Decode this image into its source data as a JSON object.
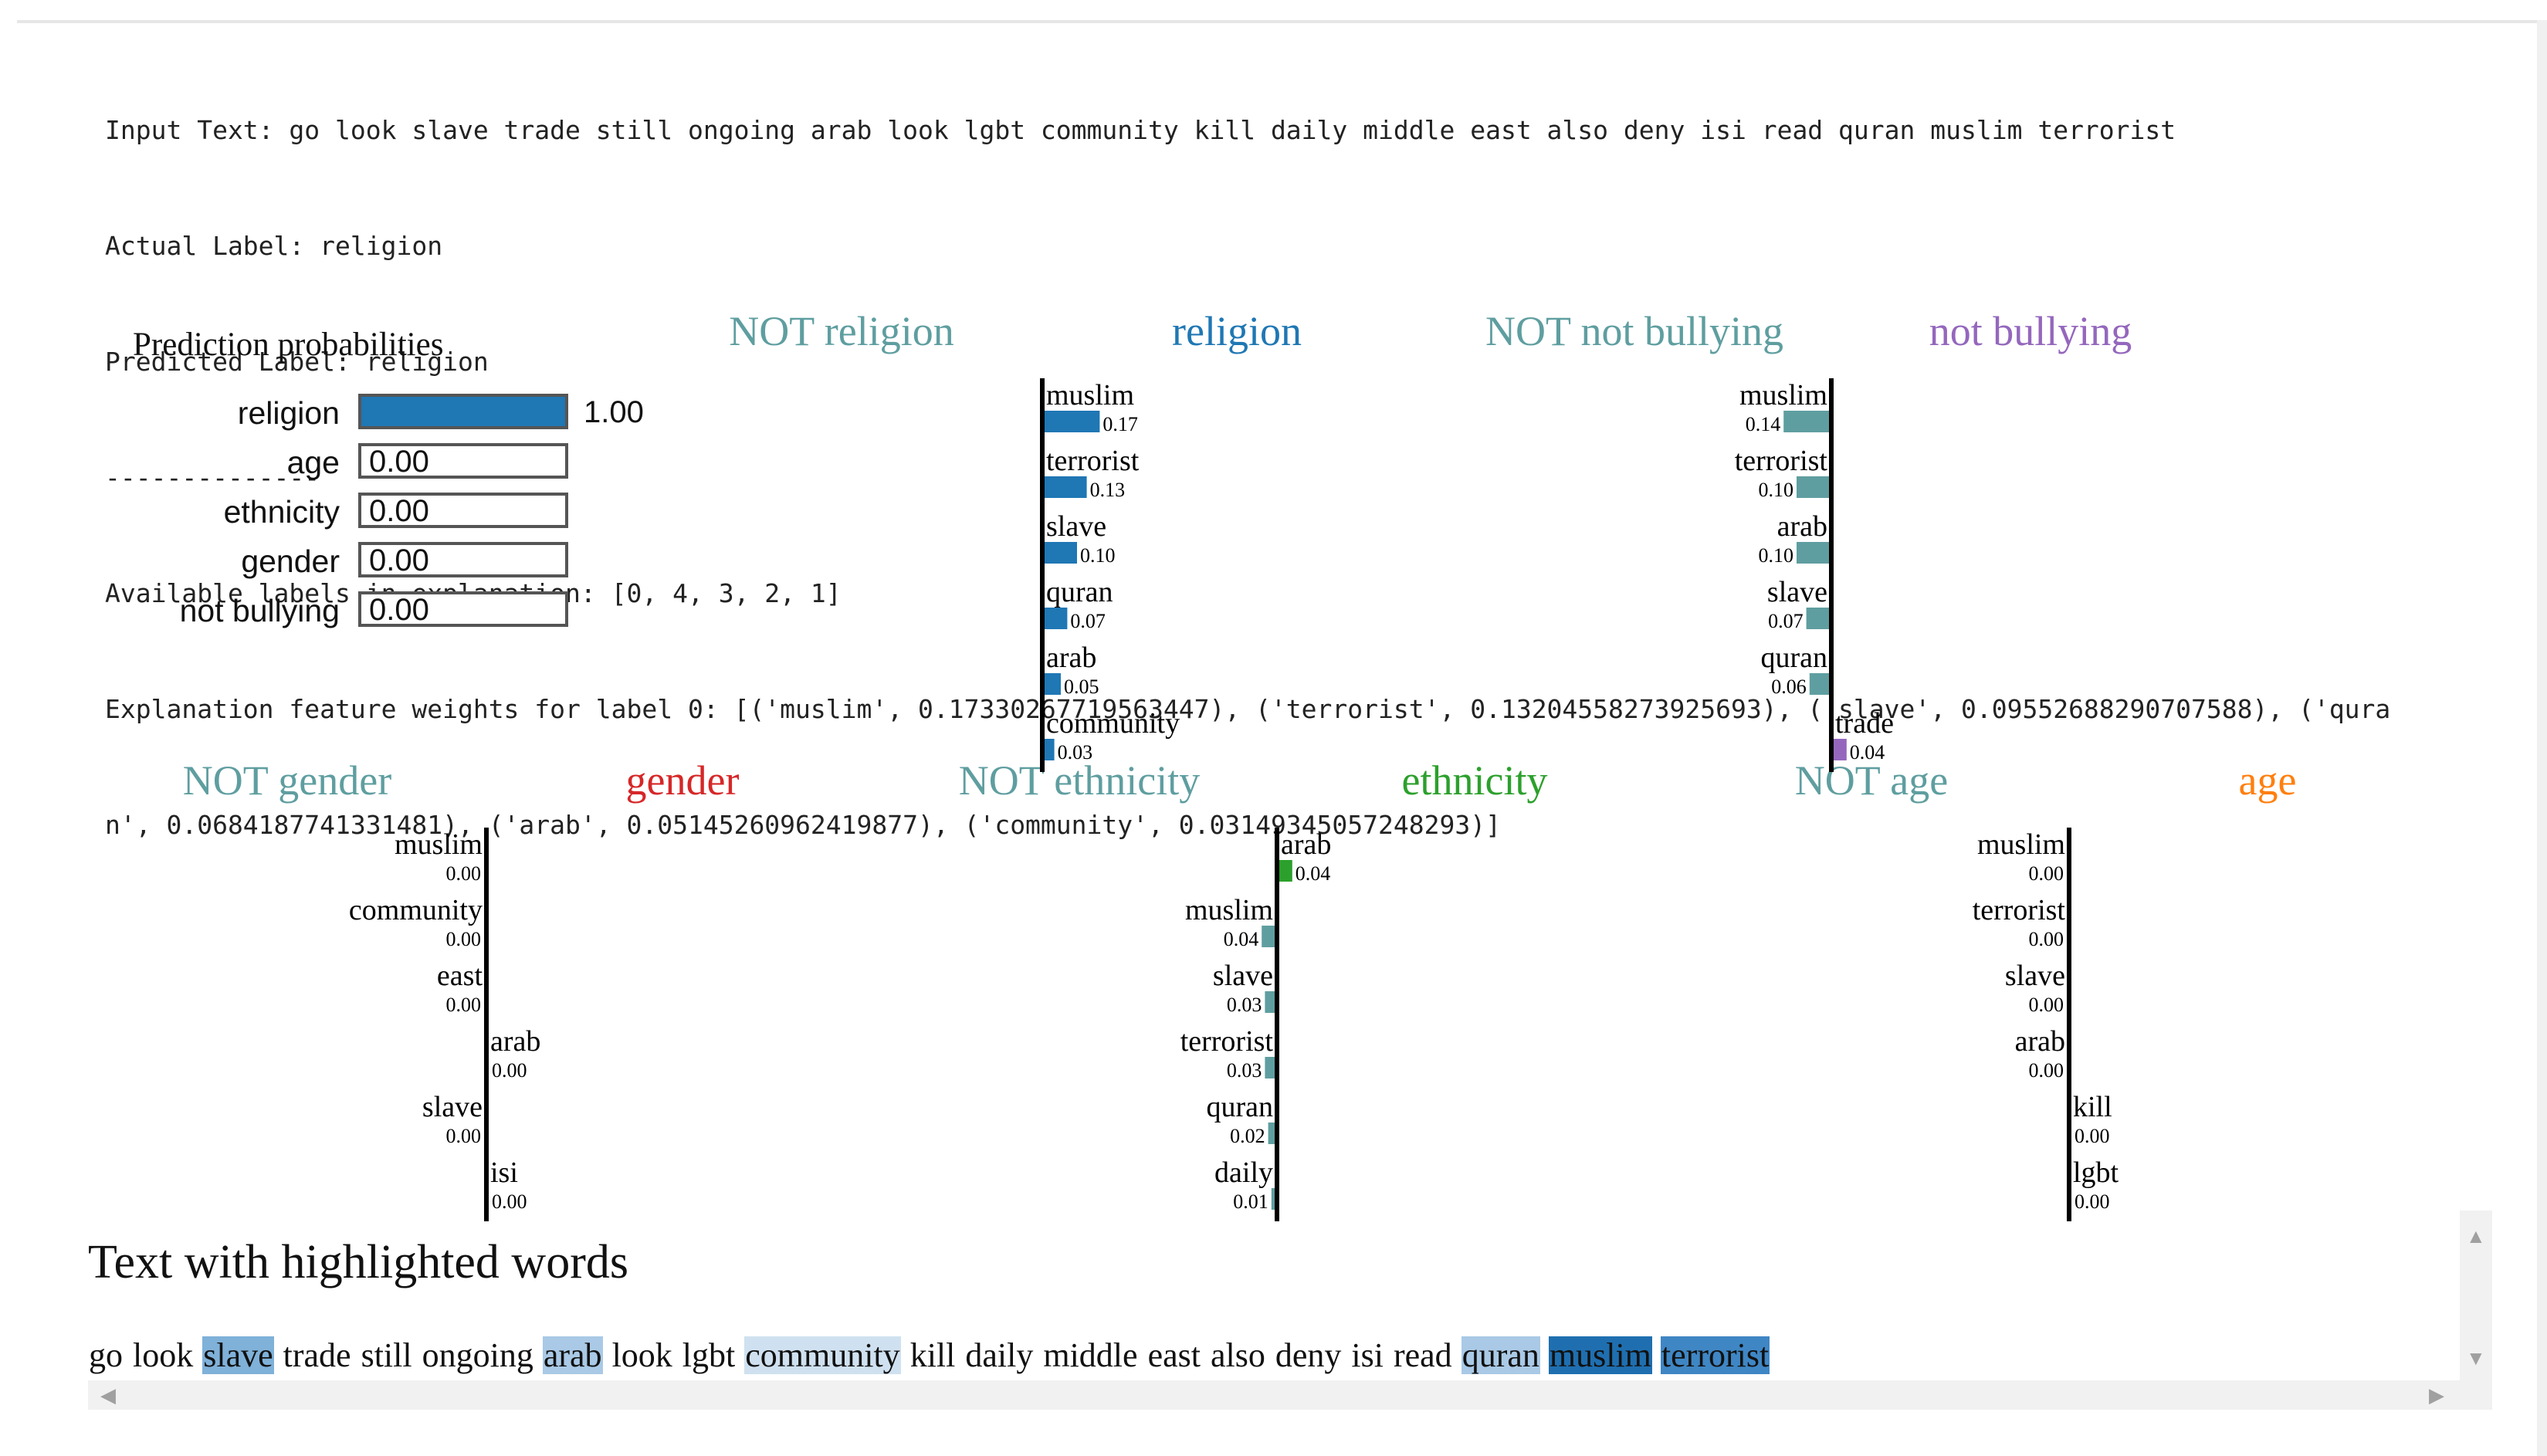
{
  "console": {
    "lines": [
      "Input Text: go look slave trade still ongoing arab look lgbt community kill daily middle east also deny isi read quran muslim terrorist",
      "Actual Label: religion",
      "Predicted Label: religion",
      "--------------",
      "Available labels in explanation: [0, 4, 3, 2, 1]",
      "Explanation feature weights for label 0: [('muslim', 0.17330267719563447), ('terrorist', 0.13204558273925693), ('slave', 0.09552688290707588), ('qura",
      "n', 0.0684187741331481), ('arab', 0.05145260962419877), ('community', 0.03149345057248293)]"
    ]
  },
  "prediction": {
    "title": "Prediction probabilities",
    "rows": [
      {
        "label": "religion",
        "value": 1.0,
        "value_text": "1.00",
        "color": "#1f77b4"
      },
      {
        "label": "age",
        "value": 0.0,
        "value_text": "0.00",
        "color": "#ff7f0e"
      },
      {
        "label": "ethnicity",
        "value": 0.0,
        "value_text": "0.00",
        "color": "#2ca02c"
      },
      {
        "label": "gender",
        "value": 0.0,
        "value_text": "0.00",
        "color": "#d62728"
      },
      {
        "label": "not bullying",
        "value": 0.0,
        "value_text": "0.00",
        "color": "#9467bd"
      }
    ]
  },
  "colors": {
    "not_color": "#5f9ea0",
    "religion": "#1f77b4",
    "not bullying": "#9467bd",
    "gender": "#d62728",
    "ethnicity": "#2ca02c",
    "age": "#ff7f0e",
    "highlight_strong": "#1f6fb0",
    "highlight_mid": "#7fb1d9",
    "highlight_light": "#cfe1f0"
  },
  "chart_data": [
    {
      "type": "bar",
      "not_label": "NOT religion",
      "label": "religion",
      "color_key": "religion",
      "features": [
        {
          "word": "muslim",
          "value": 0.17,
          "value_text": "0.17",
          "side": "pos"
        },
        {
          "word": "terrorist",
          "value": 0.13,
          "value_text": "0.13",
          "side": "pos"
        },
        {
          "word": "slave",
          "value": 0.1,
          "value_text": "0.10",
          "side": "pos"
        },
        {
          "word": "quran",
          "value": 0.07,
          "value_text": "0.07",
          "side": "pos"
        },
        {
          "word": "arab",
          "value": 0.05,
          "value_text": "0.05",
          "side": "pos"
        },
        {
          "word": "community",
          "value": 0.03,
          "value_text": "0.03",
          "side": "pos"
        }
      ]
    },
    {
      "type": "bar",
      "not_label": "NOT not bullying",
      "label": "not bullying",
      "color_key": "not bullying",
      "features": [
        {
          "word": "muslim",
          "value": 0.14,
          "value_text": "0.14",
          "side": "neg"
        },
        {
          "word": "terrorist",
          "value": 0.1,
          "value_text": "0.10",
          "side": "neg"
        },
        {
          "word": "arab",
          "value": 0.1,
          "value_text": "0.10",
          "side": "neg"
        },
        {
          "word": "slave",
          "value": 0.07,
          "value_text": "0.07",
          "side": "neg"
        },
        {
          "word": "quran",
          "value": 0.06,
          "value_text": "0.06",
          "side": "neg"
        },
        {
          "word": "trade",
          "value": 0.04,
          "value_text": "0.04",
          "side": "pos"
        }
      ]
    },
    {
      "type": "bar",
      "not_label": "NOT gender",
      "label": "gender",
      "color_key": "gender",
      "features": [
        {
          "word": "muslim",
          "value": 0.0,
          "value_text": "0.00",
          "side": "neg"
        },
        {
          "word": "community",
          "value": 0.0,
          "value_text": "0.00",
          "side": "neg"
        },
        {
          "word": "east",
          "value": 0.0,
          "value_text": "0.00",
          "side": "neg"
        },
        {
          "word": "arab",
          "value": 0.0,
          "value_text": "0.00",
          "side": "pos"
        },
        {
          "word": "slave",
          "value": 0.0,
          "value_text": "0.00",
          "side": "neg"
        },
        {
          "word": "isi",
          "value": 0.0,
          "value_text": "0.00",
          "side": "pos"
        }
      ]
    },
    {
      "type": "bar",
      "not_label": "NOT ethnicity",
      "label": "ethnicity",
      "color_key": "ethnicity",
      "features": [
        {
          "word": "arab",
          "value": 0.04,
          "value_text": "0.04",
          "side": "pos"
        },
        {
          "word": "muslim",
          "value": 0.04,
          "value_text": "0.04",
          "side": "neg"
        },
        {
          "word": "slave",
          "value": 0.03,
          "value_text": "0.03",
          "side": "neg"
        },
        {
          "word": "terrorist",
          "value": 0.03,
          "value_text": "0.03",
          "side": "neg"
        },
        {
          "word": "quran",
          "value": 0.02,
          "value_text": "0.02",
          "side": "neg"
        },
        {
          "word": "daily",
          "value": 0.01,
          "value_text": "0.01",
          "side": "neg"
        }
      ]
    },
    {
      "type": "bar",
      "not_label": "NOT age",
      "label": "age",
      "color_key": "age",
      "features": [
        {
          "word": "muslim",
          "value": 0.0,
          "value_text": "0.00",
          "side": "neg"
        },
        {
          "word": "terrorist",
          "value": 0.0,
          "value_text": "0.00",
          "side": "neg"
        },
        {
          "word": "slave",
          "value": 0.0,
          "value_text": "0.00",
          "side": "neg"
        },
        {
          "word": "arab",
          "value": 0.0,
          "value_text": "0.00",
          "side": "neg"
        },
        {
          "word": "kill",
          "value": 0.0,
          "value_text": "0.00",
          "side": "pos"
        },
        {
          "word": "lgbt",
          "value": 0.0,
          "value_text": "0.00",
          "side": "pos"
        }
      ]
    }
  ],
  "highlight": {
    "title": "Text with highlighted words",
    "words": [
      {
        "text": "go",
        "level": "none"
      },
      {
        "text": "look",
        "level": "none"
      },
      {
        "text": "slave",
        "level": "mid"
      },
      {
        "text": "trade",
        "level": "none"
      },
      {
        "text": "still",
        "level": "none"
      },
      {
        "text": "ongoing",
        "level": "none"
      },
      {
        "text": "arab",
        "level": "mid_light"
      },
      {
        "text": "look",
        "level": "none"
      },
      {
        "text": "lgbt",
        "level": "none"
      },
      {
        "text": "community",
        "level": "light"
      },
      {
        "text": "kill",
        "level": "none"
      },
      {
        "text": "daily",
        "level": "none"
      },
      {
        "text": "middle",
        "level": "none"
      },
      {
        "text": "east",
        "level": "none"
      },
      {
        "text": "also",
        "level": "none"
      },
      {
        "text": "deny",
        "level": "none"
      },
      {
        "text": "isi",
        "level": "none"
      },
      {
        "text": "read",
        "level": "none"
      },
      {
        "text": "quran",
        "level": "mid_light"
      },
      {
        "text": "muslim",
        "level": "strong"
      },
      {
        "text": "terrorist",
        "level": "strong_mid"
      }
    ]
  },
  "scroll_icons": {
    "up": "▲",
    "down": "▼",
    "left": "◀",
    "right": "▶"
  }
}
